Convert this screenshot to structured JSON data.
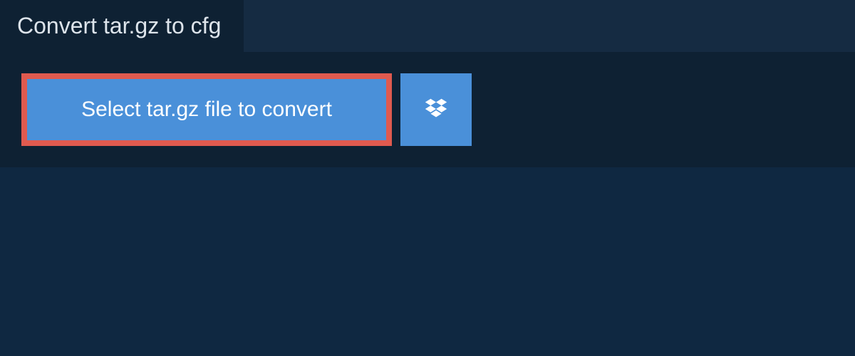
{
  "tab": {
    "title": "Convert tar.gz to cfg"
  },
  "upload": {
    "select_button_label": "Select tar.gz file to convert",
    "dropbox_icon_name": "dropbox-icon"
  },
  "colors": {
    "page_bg": "#0f2841",
    "panel_bg": "#0e2133",
    "container_bg": "#152b42",
    "button_bg": "#4a90d9",
    "highlight_border": "#e05a4f",
    "text_light": "#dde4eb"
  }
}
